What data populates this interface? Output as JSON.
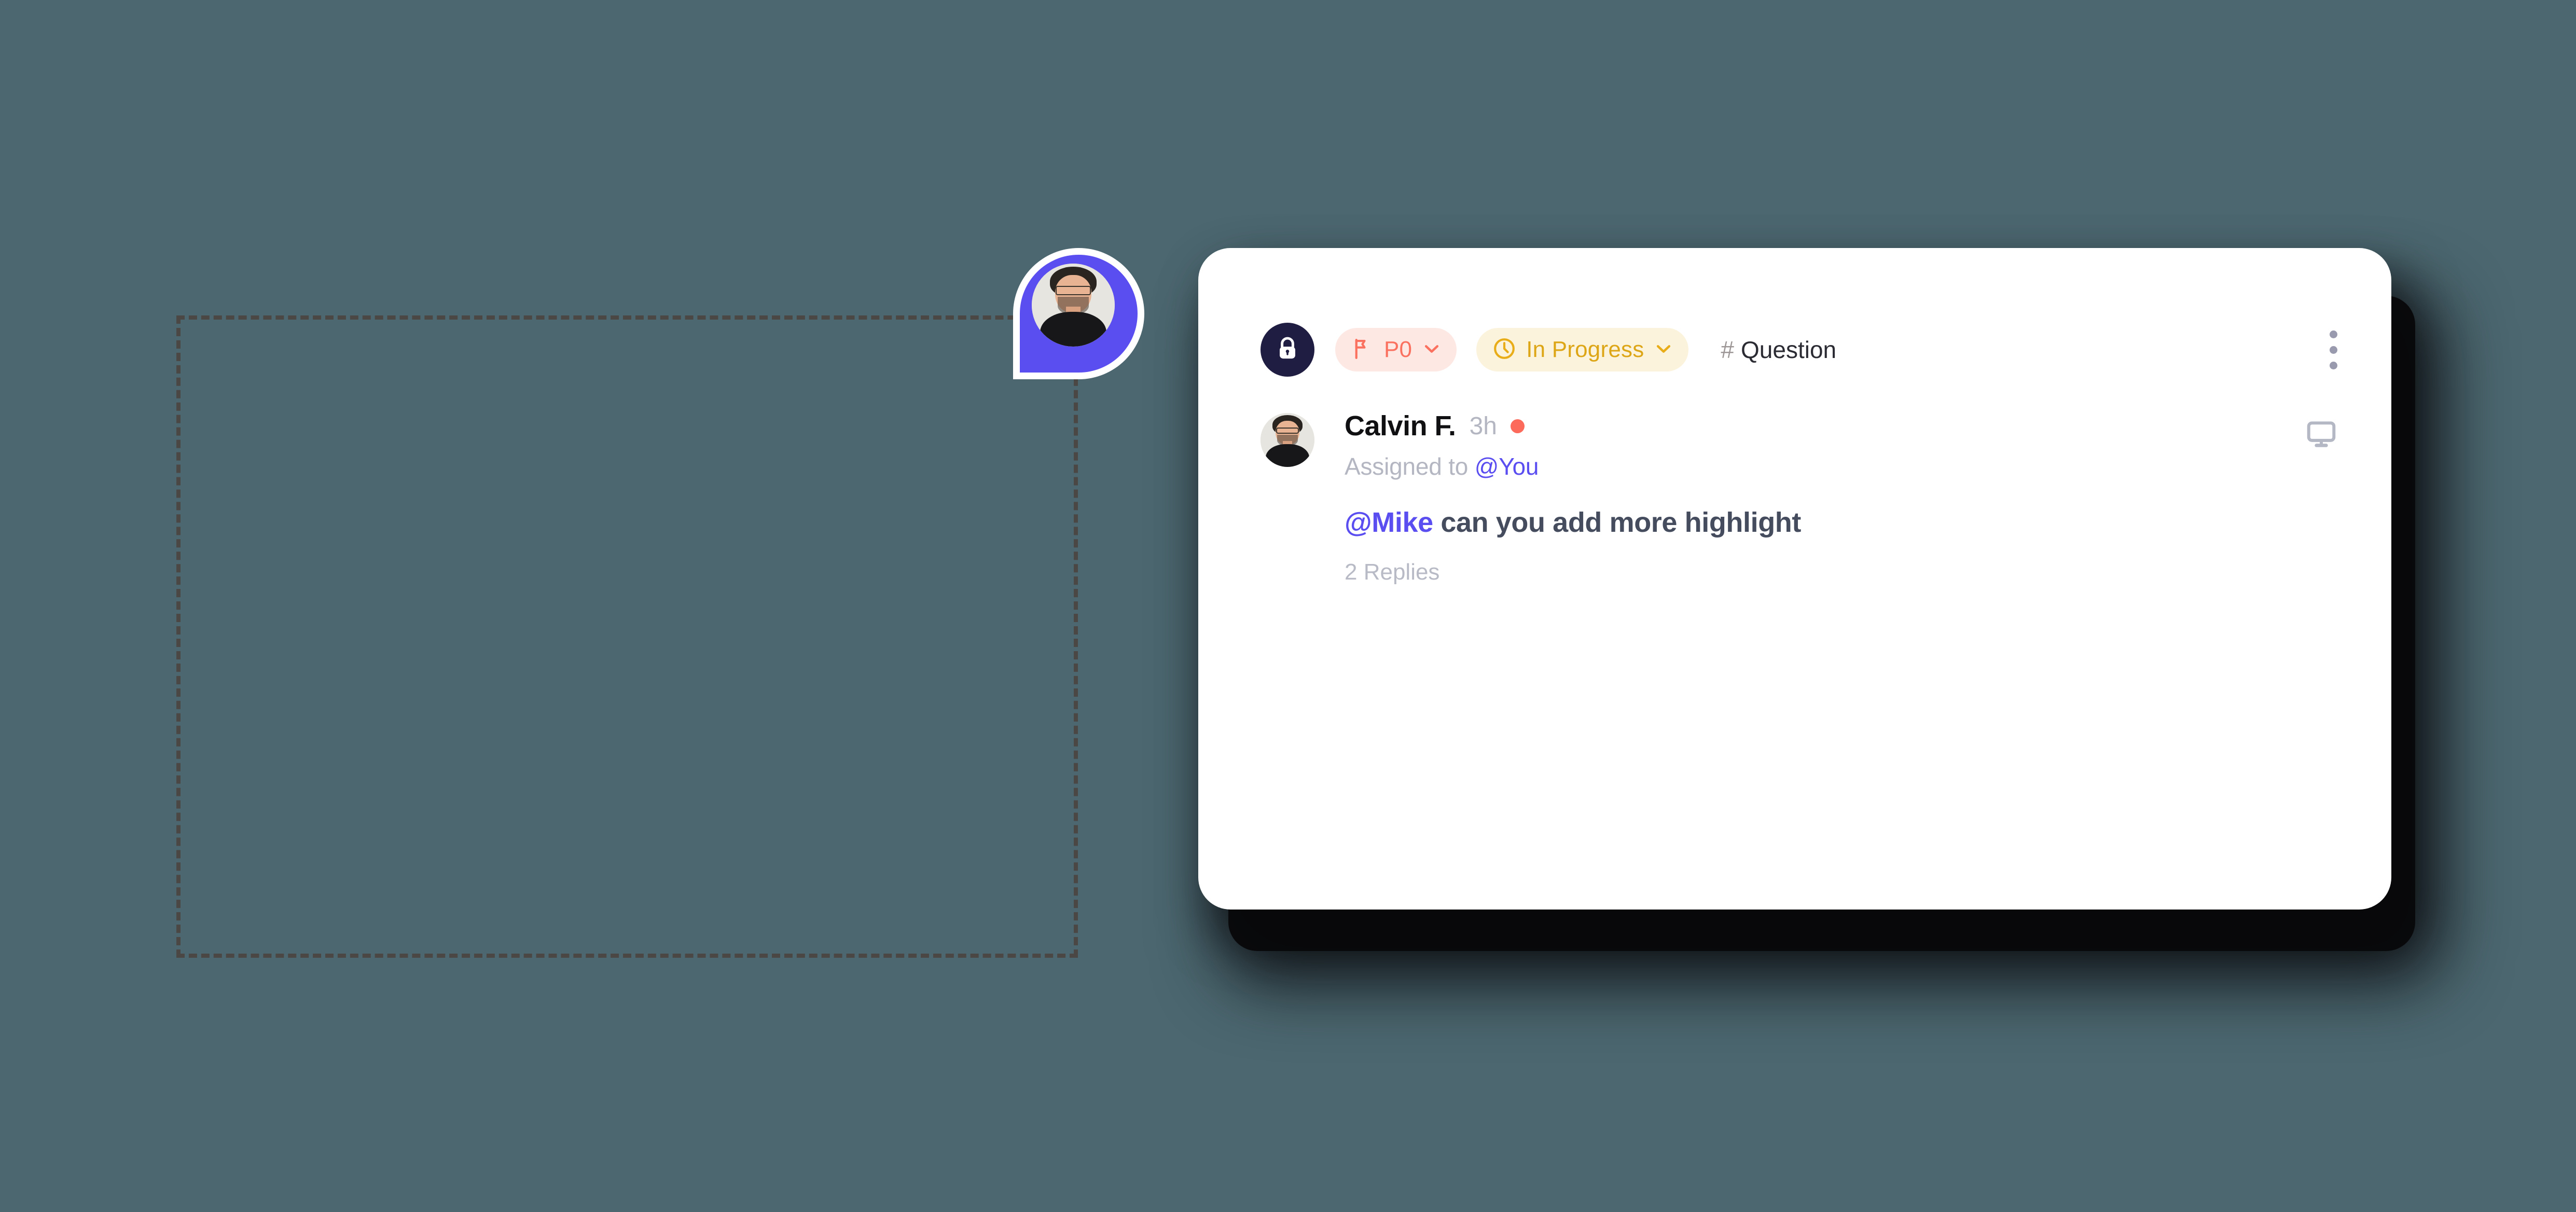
{
  "canvas": {
    "background_color": "#4c6770",
    "selection": {
      "name": "dashed-selection-region",
      "border_color": "#4a4744"
    }
  },
  "pin": {
    "name": "avatar-pin-marker",
    "ring_color": "#5b4ef0",
    "border_color": "#ffffff",
    "avatar_alt": "Calvin F."
  },
  "card": {
    "background_color": "#ffffff",
    "header": {
      "lock_icon": "lock-icon",
      "lock_badge_color": "#201d42",
      "priority": {
        "icon": "flag-icon",
        "label": "P0",
        "chevron": "chevron-down-icon",
        "text_color": "#fb7160",
        "pill_color": "#fde8e4"
      },
      "status": {
        "icon": "clock-icon",
        "label": "In Progress",
        "chevron": "chevron-down-icon",
        "text_color": "#dda617",
        "pill_color": "#fcf3dc"
      },
      "channel": {
        "hash": "#",
        "name": "Question"
      },
      "more_menu": "more-vertical-icon"
    },
    "comment": {
      "author": "Calvin F.",
      "time": "3h",
      "unread_dot_color": "#fb6a5a",
      "assignment_prefix": "Assigned to ",
      "assignee": "@You",
      "message_mention": "@Mike",
      "message_rest": " can you add more highlight",
      "replies": "2 Replies",
      "device_icon": "monitor-icon"
    }
  }
}
